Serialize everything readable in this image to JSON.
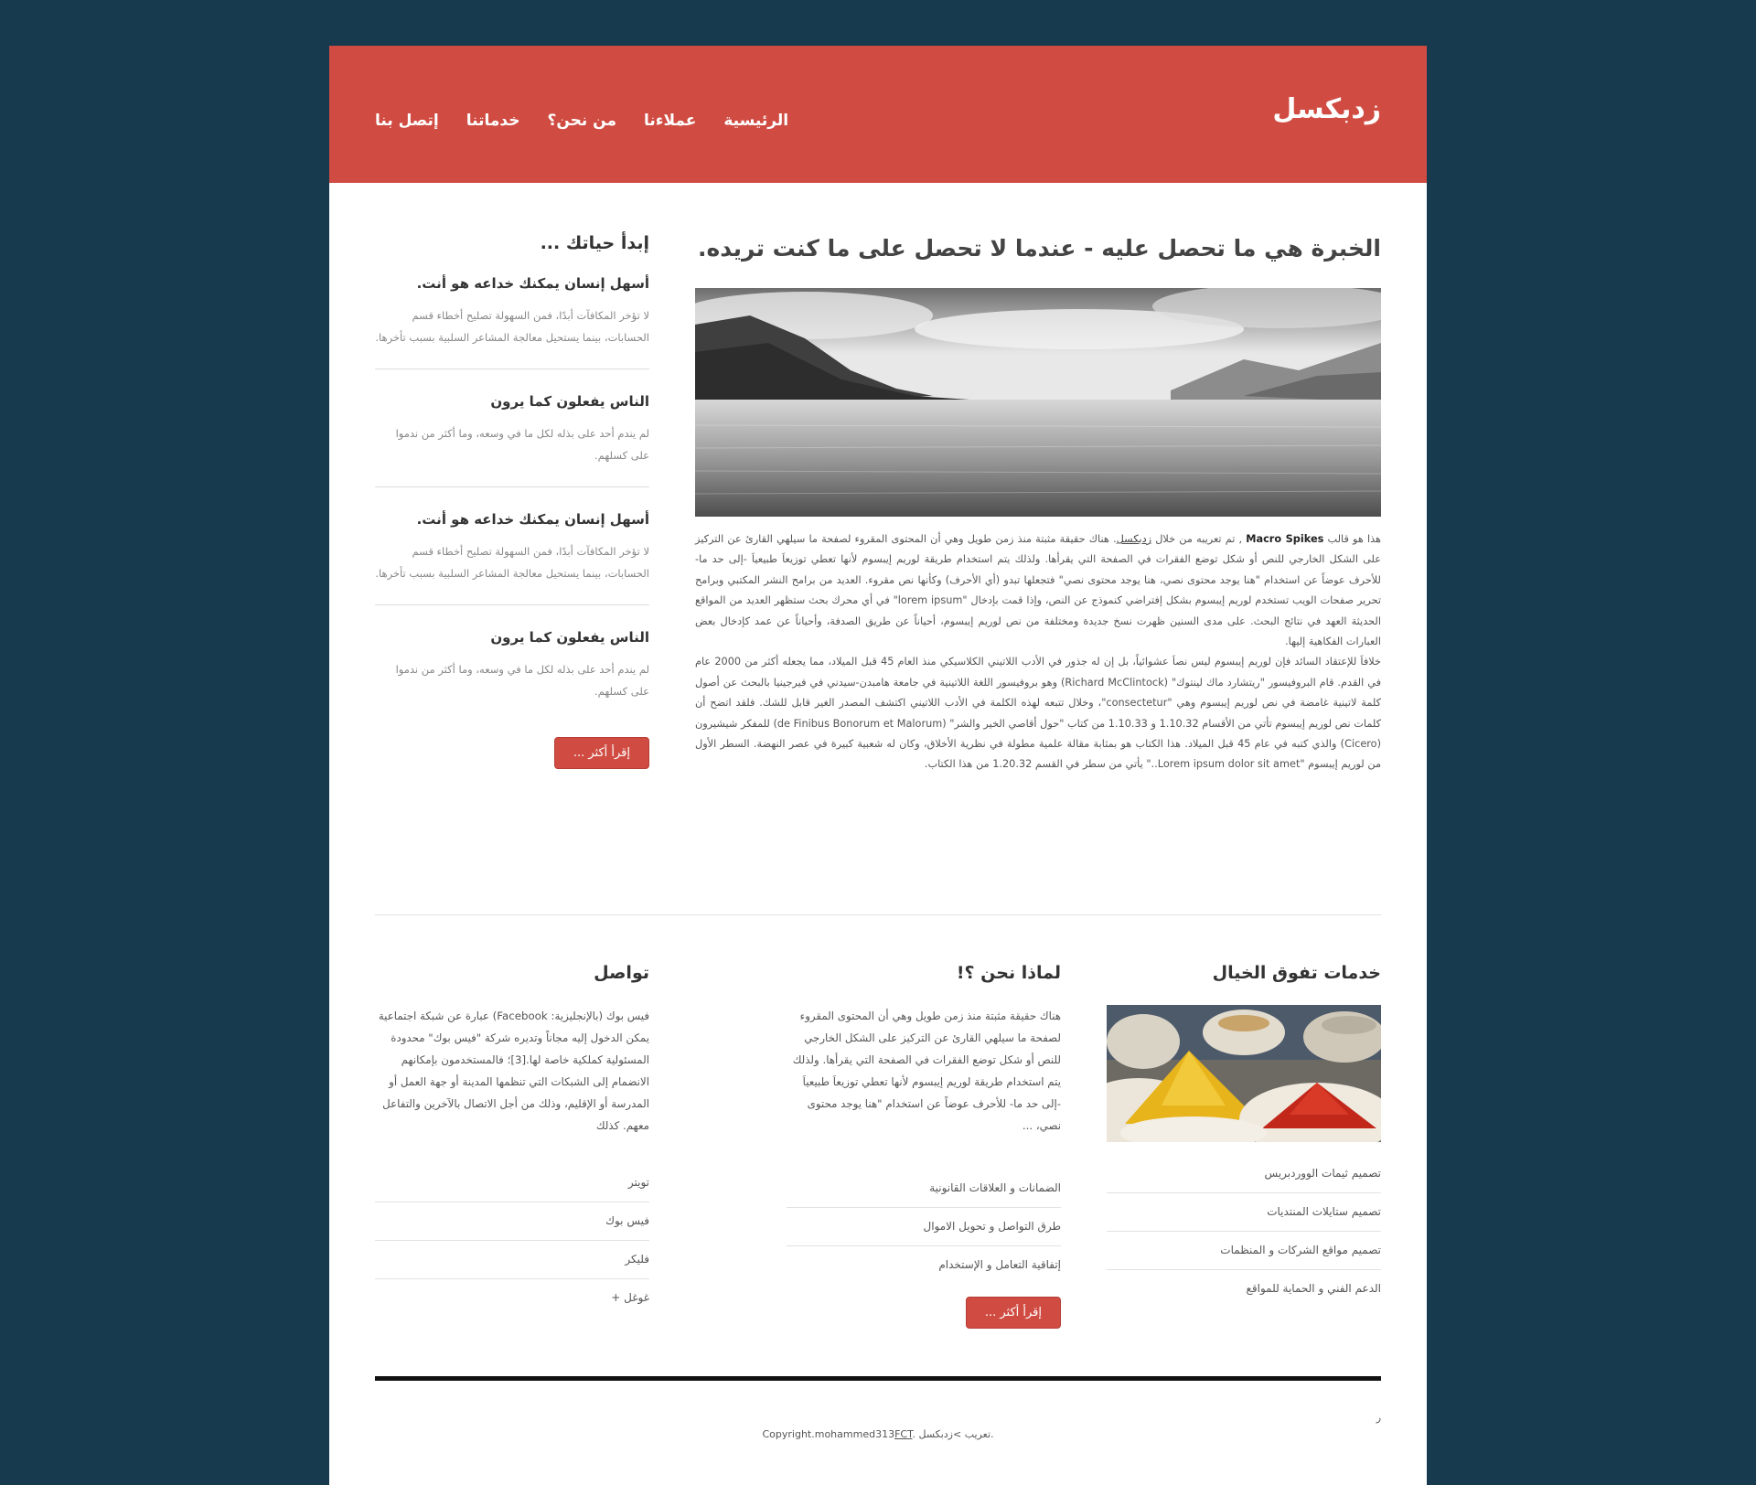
{
  "site": {
    "logo": "زدبكسل"
  },
  "nav": [
    "الرئيسية",
    "عملاءنا",
    "من نحن؟",
    "خدماتنا",
    "إتصل بنا"
  ],
  "main": {
    "title": "الخبرة هي ما تحصل عليه - عندما لا تحصل على ما كنت تريده.",
    "intro_prefix": "هذا هو قالب ",
    "intro_brand": "Macro Spikes",
    "intro_mid": " , تم تعريبه من خلال ",
    "intro_link": "زدبكسل",
    "intro_rest": ". هناك حقيقة مثبتة منذ زمن طويل وهي أن المحتوى المقروء لصفحة ما سيلهي القارئ عن التركيز على الشكل الخارجي للنص أو شكل توضع الفقرات في الصفحة التي يقرأها. ولذلك يتم استخدام طريقة لوريم إيبسوم لأنها تعطي توزيعاَ طبيعياَ -إلى حد ما- للأحرف عوضاً عن استخدام \"هنا يوجد محتوى نصي، هنا يوجد محتوى نصي\" فتجعلها تبدو (أي الأحرف) وكأنها نص مقروء. العديد من برامح النشر المكتبي وبرامح تحرير صفحات الويب تستخدم لوريم إيبسوم بشكل إفتراضي كنموذج عن النص، وإذا قمت بإدخال \"lorem ipsum\" في أي محرك بحث ستظهر العديد من المواقع الحديثة العهد في نتائج البحث. على مدى السنين ظهرت نسخ جديدة ومختلفة من نص لوريم إيبسوم، أحياناً عن طريق الصدفة، وأحياناً عن عمد كإدخال بعض العبارات الفكاهية إليها.",
    "para2": "خلافاَ للإعتقاد السائد فإن لوريم إيبسوم ليس نصاَ عشوائياً، بل إن له جذور في الأدب اللاتيني الكلاسيكي منذ العام 45 قبل الميلاد، مما يجعله أكثر من 2000 عام في القدم. قام البروفيسور \"ريتشارد ماك لينتوك\" (Richard McClintock) وهو بروفيسور اللغة اللاتينية في جامعة هامبدن-سيدني في فيرجينيا بالبحث عن أصول كلمة لاتينية غامضة في نص لوريم إيبسوم وهي \"consectetur\"، وخلال تتبعه لهذه الكلمة في الأدب اللاتيني اكتشف المصدر الغير قابل للشك. فلقد اتضح أن كلمات نص لوريم إيبسوم تأتي من الأقسام 1.10.32 و 1.10.33 من كتاب \"حول أقاصي الخير والشر\" (de Finibus Bonorum et Malorum) للمفكر شيشيرون (Cicero) والذي كتبه في عام 45 قبل الميلاد. هذا الكتاب هو بمثابة مقالة علمية مطولة في نظرية الأخلاق، وكان له شعبية كبيرة في عصر النهضة. السطر الأول من لوريم إيبسوم \"Lorem ipsum dolor sit amet..\" يأتي من سطر في القسم 1.20.32 من هذا الكتاب."
  },
  "sidebar": {
    "title": "إبدأ حياتك ...",
    "posts": [
      {
        "title": "أسهل إنسان يمكنك خداعه هو أنت.",
        "text": "لا تؤخر المكافآت أبدًا، فمن السهولة تصليح أخطاء قسم الحسابات، بينما يستحيل معالجة المشاعر السلبية بسبب تأخرها."
      },
      {
        "title": "الناس يفعلون كما يرون",
        "text": "لم يندم أحد على بذله لكل ما في وسعه، وما أكثر من ندموا على كسلهم."
      },
      {
        "title": "أسهل إنسان يمكنك خداعه هو أنت.",
        "text": "لا تؤخر المكافآت أبدًا، فمن السهولة تصليح أخطاء قسم الحسابات، بينما يستحيل معالجة المشاعر السلبية بسبب تأخرها."
      },
      {
        "title": "الناس يفعلون كما يرون",
        "text": "لم يندم أحد على بذله لكل ما في وسعه، وما أكثر من ندموا على كسلهم."
      }
    ],
    "button": "إقرأ أكثر ..."
  },
  "services": {
    "title": "خدمات تفوق الخيال",
    "items": [
      "تصميم ثيمات الووردبريس",
      "تصميم ستايلات المنتديات",
      "تصميم مواقع الشركات و المنظمات",
      "الدعم الفني و الحماية للمواقع"
    ]
  },
  "why": {
    "title": "لماذا نحن ؟!",
    "text": "هناك حقيقة مثبتة منذ زمن طويل وهي أن المحتوى المقروء لصفحة ما سيلهي القارئ عن التركيز على الشكل الخارجي للنص أو شكل توضع الفقرات في الصفحة التي يقرأها. ولذلك يتم استخدام طريقة لوريم إيبسوم لأنها تعطي توزيعاَ طبيعياَ -إلى حد ما- للأحرف عوضاً عن استخدام \"هنا يوجد محتوى نصي، ...",
    "items": [
      "الضمانات و العلاقات القانونية",
      "طرق التواصل و تحويل الاموال",
      "إتفاقية التعامل و الإستخدام"
    ],
    "button": "إقرأ أكثر ..."
  },
  "contact": {
    "title": "تواصل",
    "text": "فيس بوك (بالإنجليزية: Facebook) عبارة عن شبكة اجتماعية يمكن الدخول إليه مجاناً وتديره شركة \"فيس بوك\" محدودة المسئولية كملكية خاصة لها.[3]؛ فالمستخدمون بإمكانهم الانضمام إلى الشبكات التي تنظمها المدينة أو جهة العمل أو المدرسة أو الإقليم، وذلك من أجل الاتصال بالآخرين والتفاعل معهم. كذلك",
    "items": [
      "تويتر",
      "فيس بوك",
      "فليكر",
      "غوغل +"
    ]
  },
  "footer": {
    "small": "ر",
    "copy_prefix": "Copyright.mohammed313",
    "copy_link": "FCT",
    "copy_suffix": ". تعريب >زدبكسل."
  }
}
